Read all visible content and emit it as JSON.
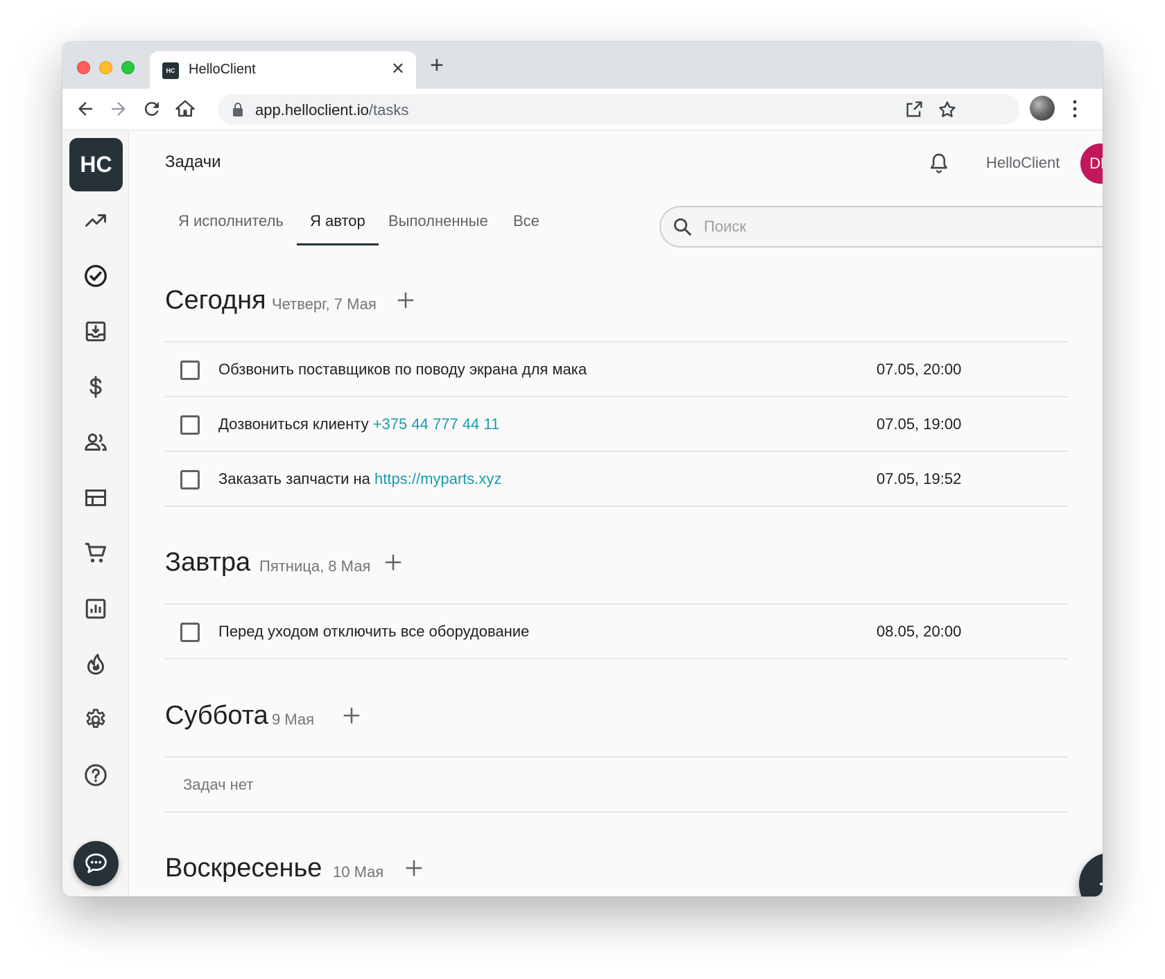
{
  "browser": {
    "tab_title": "HelloClient",
    "favicon_text": "HC",
    "url_host": "app.helloclient.io",
    "url_path": "/tasks"
  },
  "sidebar": {
    "logo": "HC",
    "items": [
      {
        "name": "analytics",
        "icon": "trending-up-icon"
      },
      {
        "name": "tasks",
        "icon": "check-circle-icon"
      },
      {
        "name": "inbox",
        "icon": "inbox-download-icon"
      },
      {
        "name": "finance",
        "icon": "dollar-icon"
      },
      {
        "name": "clients",
        "icon": "people-icon"
      },
      {
        "name": "tables",
        "icon": "table-icon"
      },
      {
        "name": "shop",
        "icon": "cart-icon"
      },
      {
        "name": "reports",
        "icon": "bar-chart-icon"
      },
      {
        "name": "hot",
        "icon": "fire-icon"
      },
      {
        "name": "settings",
        "icon": "gear-icon"
      },
      {
        "name": "help",
        "icon": "help-circle-icon"
      }
    ],
    "chat_icon": "chat-bubble-icon"
  },
  "header": {
    "title": "Задачи",
    "account_name": "HelloClient",
    "avatar_initials": "DN",
    "avatar_color": "#c2185b"
  },
  "filters": {
    "tabs": [
      {
        "label": "Я исполнитель",
        "active": false
      },
      {
        "label": "Я автор",
        "active": true
      },
      {
        "label": "Выполненные",
        "active": false
      },
      {
        "label": "Все",
        "active": false
      }
    ],
    "search_placeholder": "Поиск"
  },
  "sections": [
    {
      "title": "Сегодня",
      "subtitle": "Четверг, 7 Мая",
      "tasks": [
        {
          "text": "Обзвонить поставщиков по поводу экрана для мака",
          "link": "",
          "time": "07.05, 20:00"
        },
        {
          "text": "Дозвониться клиенту ",
          "link": "+375 44 777 44 11",
          "time": "07.05, 19:00"
        },
        {
          "text": "Заказать запчасти на ",
          "link": "https://myparts.xyz",
          "time": "07.05, 19:52"
        }
      ]
    },
    {
      "title": "Завтра",
      "subtitle": "Пятница, 8 Мая",
      "tasks": [
        {
          "text": "Перед уходом отключить все оборудование",
          "link": "",
          "time": "08.05, 20:00"
        }
      ]
    },
    {
      "title": "Суббота",
      "subtitle": "9 Мая",
      "empty_text": "Задач нет"
    },
    {
      "title": "Воскресенье",
      "subtitle": "10 Мая"
    }
  ],
  "colors": {
    "brand_dark": "#263238",
    "link": "#1a9bb0"
  }
}
